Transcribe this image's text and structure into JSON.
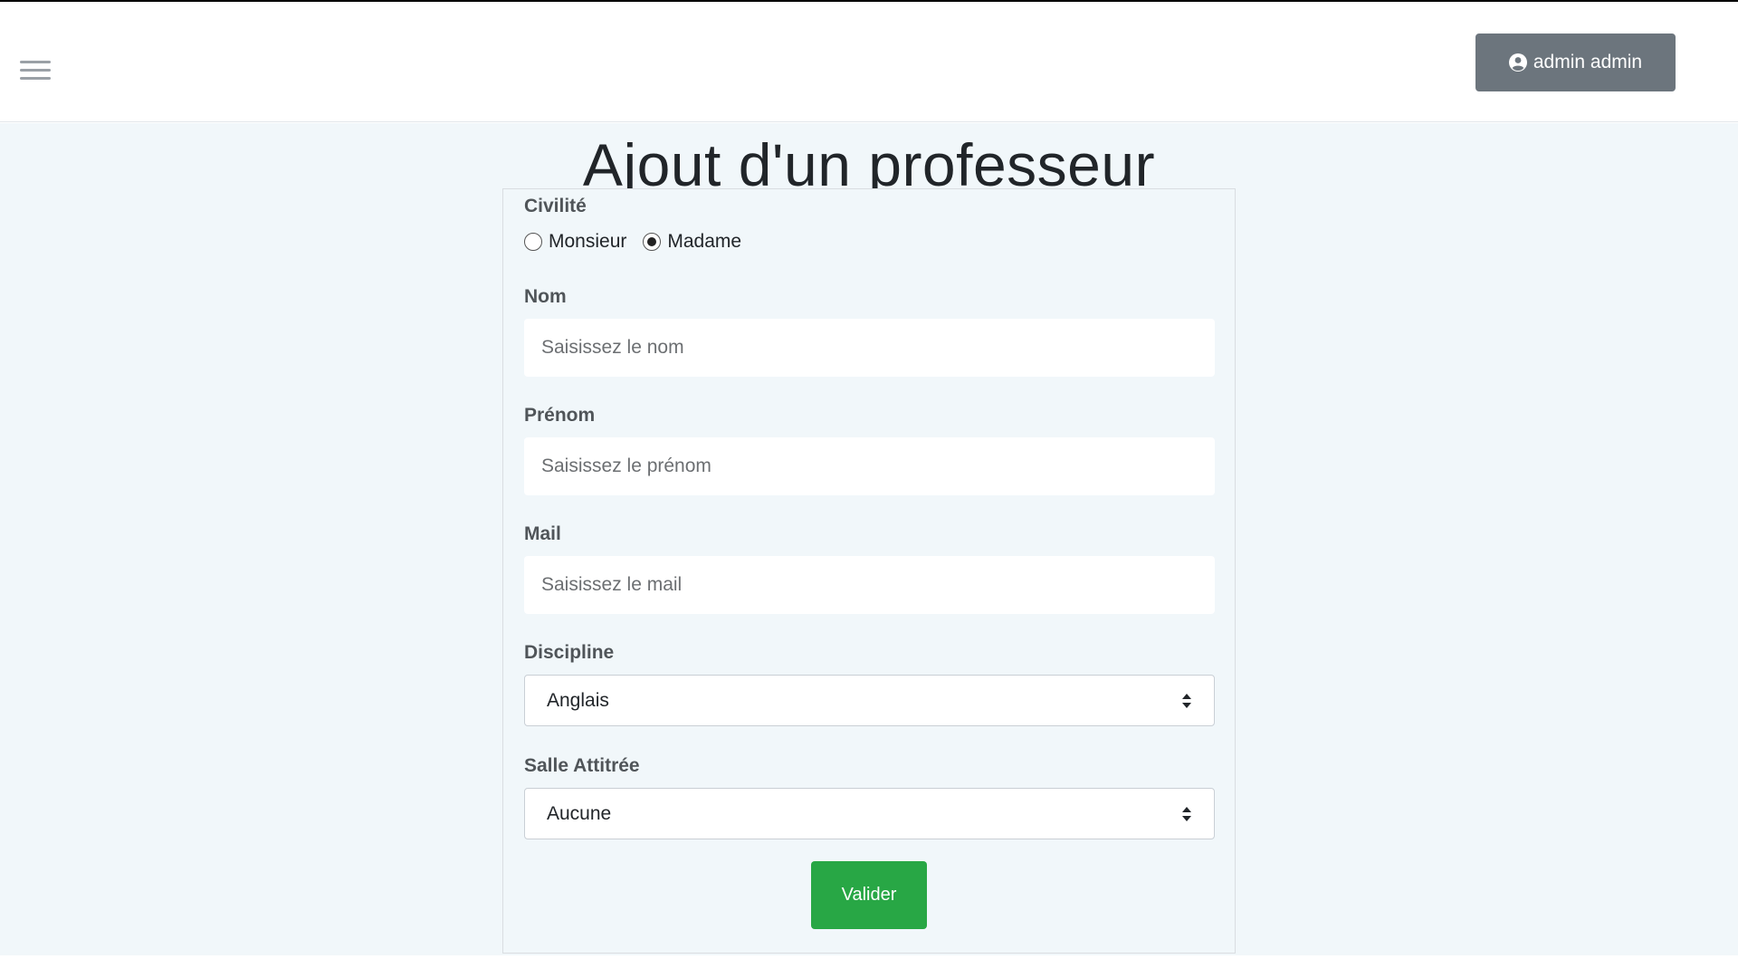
{
  "header": {
    "menu_icon": "hamburger-icon",
    "user_icon": "user-circle-icon",
    "user_label": "admin admin",
    "user_button_color": "#6c757d"
  },
  "page": {
    "title": "Ajout d'un professeur",
    "background": "#f1f7fa"
  },
  "form": {
    "civilite": {
      "label": "Civilité",
      "options": [
        {
          "label": "Monsieur",
          "checked": false
        },
        {
          "label": "Madame",
          "checked": true
        }
      ]
    },
    "nom": {
      "label": "Nom",
      "placeholder": "Saisissez le nom",
      "value": ""
    },
    "prenom": {
      "label": "Prénom",
      "placeholder": "Saisissez le prénom",
      "value": ""
    },
    "mail": {
      "label": "Mail",
      "placeholder": "Saisissez le mail",
      "value": ""
    },
    "discipline": {
      "label": "Discipline",
      "selected": "Anglais",
      "icon": "sort-icon"
    },
    "salle": {
      "label": "Salle Attitrée",
      "selected": "Aucune",
      "icon": "sort-icon"
    },
    "submit": {
      "label": "Valider",
      "color": "#28a745"
    }
  }
}
